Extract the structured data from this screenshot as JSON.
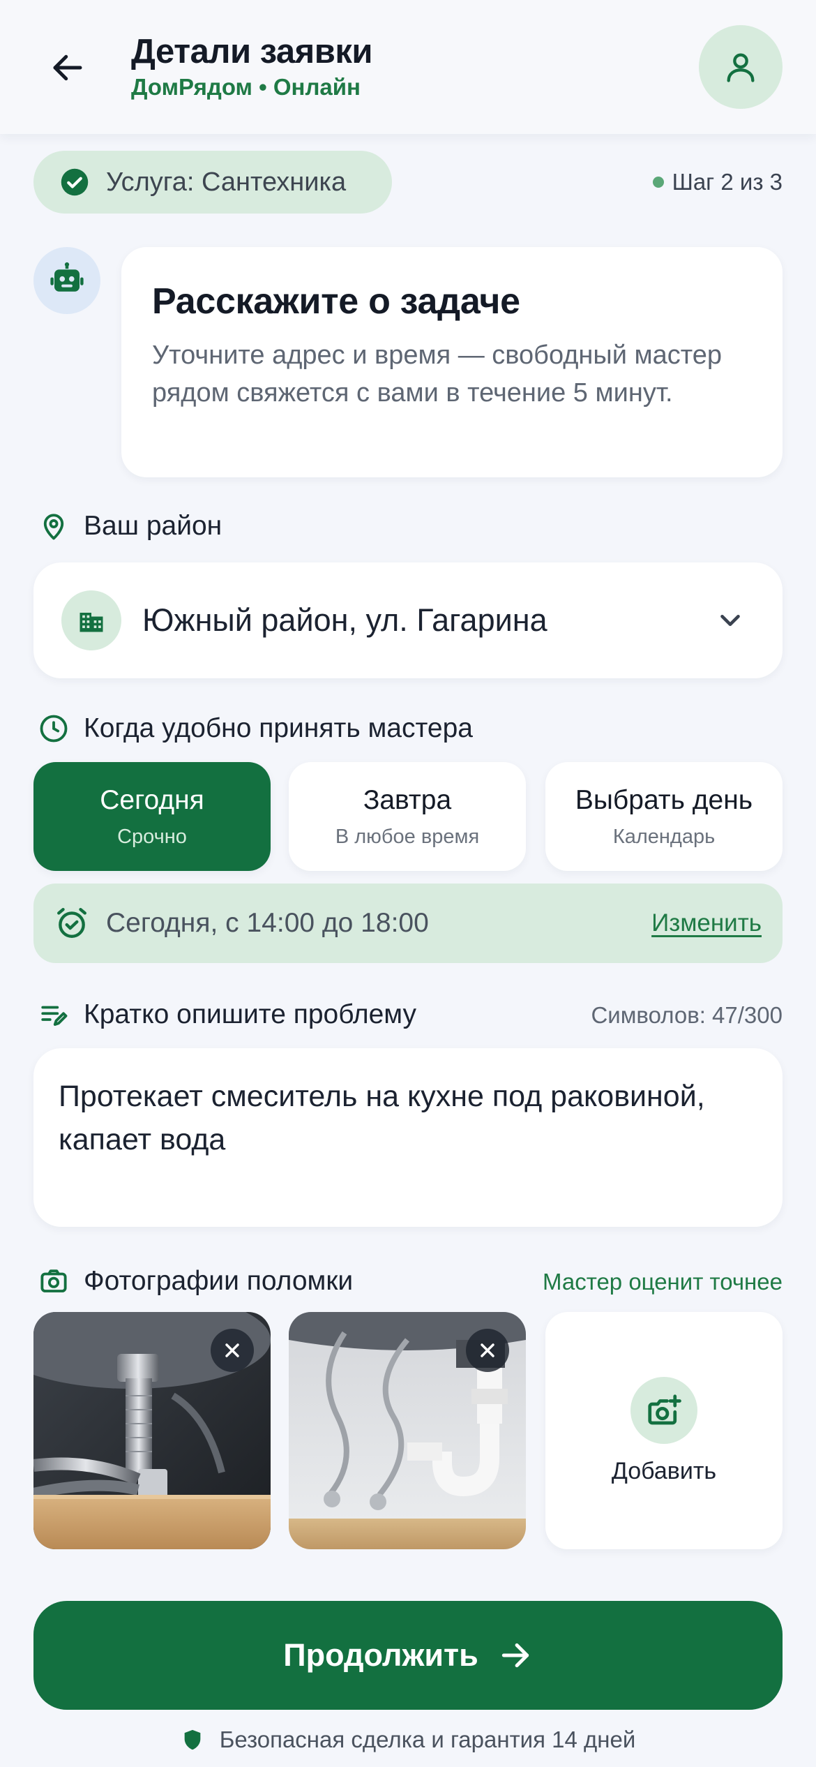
{
  "header": {
    "title": "Детали заявки",
    "subtitle": "ДомРядом • Онлайн"
  },
  "service": {
    "chip_label": "Услуга: Сантехника",
    "step_label": "Шаг 2 из 3"
  },
  "bot": {
    "title": "Расскажите о задаче",
    "message": "Уточните адрес и время — свободный мастер рядом свяжется с вами в течение 5 минут."
  },
  "district": {
    "label": "Ваш район",
    "value": "Южный район, ул. Гагарина"
  },
  "time": {
    "label": "Когда удобно принять мастера",
    "options": [
      {
        "title": "Сегодня",
        "subtitle": "Срочно",
        "selected": true
      },
      {
        "title": "Завтра",
        "subtitle": "В любое время",
        "selected": false
      },
      {
        "title": "Выбрать день",
        "subtitle": "Календарь",
        "selected": false
      }
    ],
    "selected_text": "Сегодня, с 14:00 до 18:00",
    "change_label": "Изменить"
  },
  "description": {
    "label": "Кратко опишите проблему",
    "counter": "Символов: 47/300",
    "value": "Протекает смеситель на кухне под раковиной, капает вода"
  },
  "photos": {
    "label": "Фотографии поломки",
    "hint": "Мастер оценит точнее",
    "add_label": "Добавить"
  },
  "actions": {
    "continue_label": "Продолжить",
    "guarantee": "Безопасная сделка и гарантия 14 дней"
  },
  "colors": {
    "brand_green": "#137040",
    "accent_text_green": "#1f7a45",
    "soft_green": "#d8ebde",
    "background": "#f4f6fb"
  }
}
